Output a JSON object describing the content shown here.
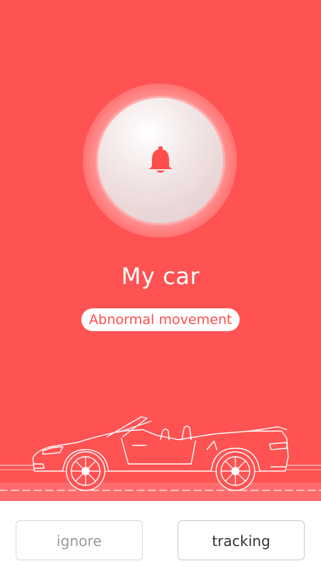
{
  "alarm": {
    "icon": "bell-icon",
    "icon_color": "#ff4d4d"
  },
  "vehicle": {
    "name": "My car",
    "status": "Abnormal movement"
  },
  "actions": {
    "ignore_label": "ignore",
    "tracking_label": "tracking"
  },
  "colors": {
    "background": "#ff5252",
    "accent": "#ff4d4d",
    "bottom_bar": "#ffffff"
  }
}
